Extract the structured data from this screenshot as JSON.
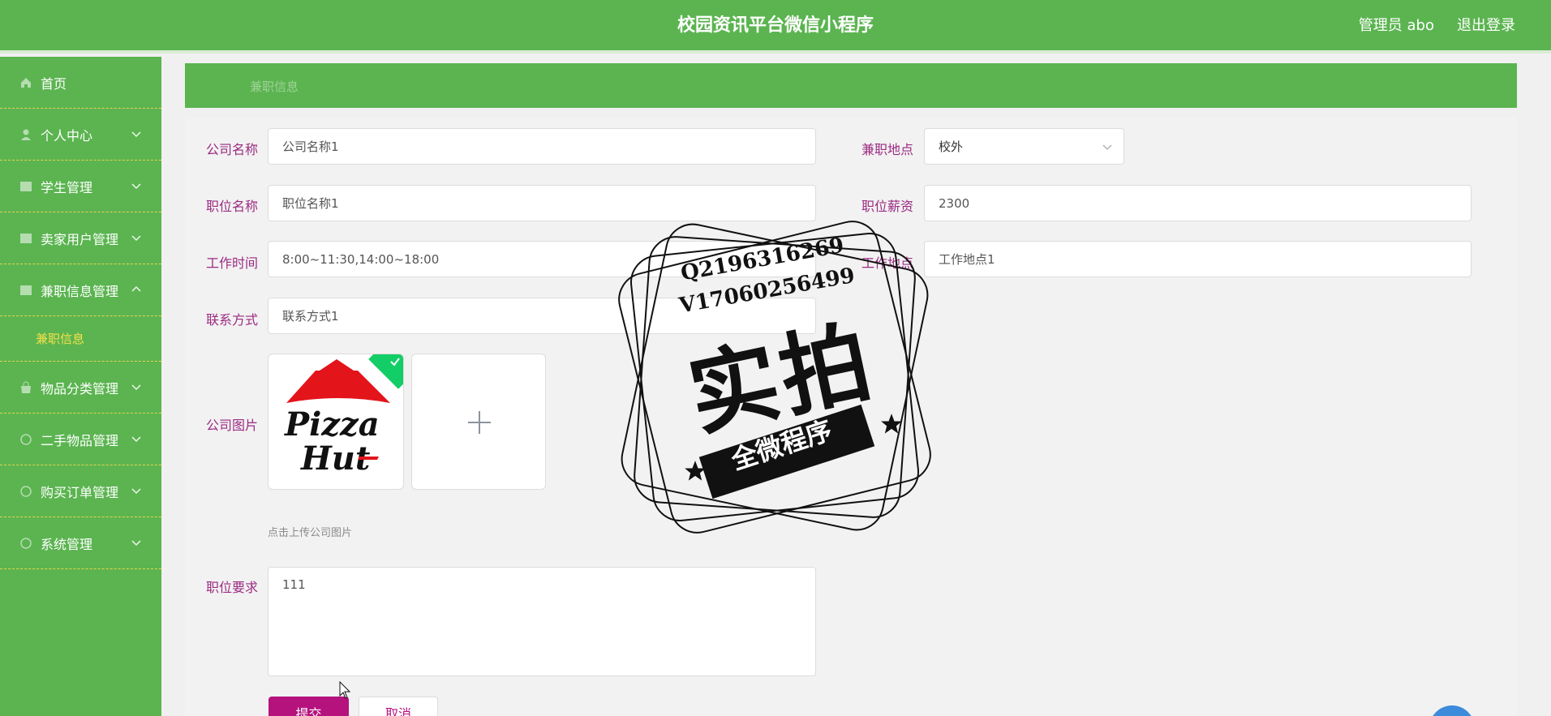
{
  "header": {
    "title": "校园资讯平台微信小程序",
    "user": "管理员 abo",
    "logout": "退出登录"
  },
  "sidebar": {
    "items": [
      {
        "label": "首页",
        "icon": "home-icon",
        "chevron": false
      },
      {
        "label": "个人中心",
        "icon": "user-icon",
        "chevron": "down"
      },
      {
        "label": "学生管理",
        "icon": "grid-icon",
        "chevron": "down"
      },
      {
        "label": "卖家用户管理",
        "icon": "grid-icon",
        "chevron": "down"
      },
      {
        "label": "兼职信息管理",
        "icon": "grid-icon",
        "chevron": "up"
      },
      {
        "label": "物品分类管理",
        "icon": "bag-icon",
        "chevron": "down"
      },
      {
        "label": "二手物品管理",
        "icon": "circle-icon",
        "chevron": "down"
      },
      {
        "label": "购买订单管理",
        "icon": "circle-icon",
        "chevron": "down"
      },
      {
        "label": "系统管理",
        "icon": "circle-icon",
        "chevron": "down"
      }
    ],
    "active_subitem": "兼职信息"
  },
  "breadcrumb": "兼职信息",
  "form": {
    "company_name": {
      "label": "公司名称",
      "value": "公司名称1"
    },
    "location": {
      "label": "兼职地点",
      "value": "校外"
    },
    "position_name": {
      "label": "职位名称",
      "value": "职位名称1"
    },
    "salary": {
      "label": "职位薪资",
      "value": "2300"
    },
    "work_time": {
      "label": "工作时间",
      "value": "8:00~11:30,14:00~18:00"
    },
    "work_place": {
      "label": "工作地点",
      "value": "工作地点1"
    },
    "contact": {
      "label": "联系方式",
      "value": "联系方式1"
    },
    "company_image": {
      "label": "公司图片",
      "hint": "点击上传公司图片",
      "logo_top": "Pizza",
      "logo_bottom": "Hut"
    },
    "requirements": {
      "label": "职位要求",
      "value": "111"
    },
    "submit_label": "提交",
    "cancel_label": "取消"
  },
  "watermark": {
    "line1": "Q2196316269",
    "line2": "V17060256499",
    "big": "实拍",
    "ribbon": "全微程序"
  },
  "colors": {
    "primary_green": "#5bb450",
    "label_magenta": "#9b2b82",
    "submit_magenta": "#b5127e",
    "submenu_yellow": "#f2e04a"
  }
}
